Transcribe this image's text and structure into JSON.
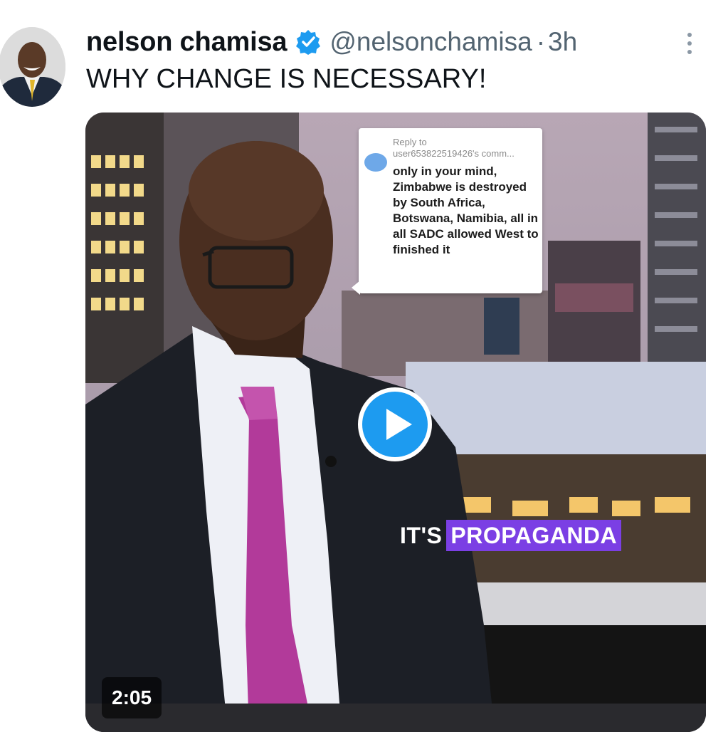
{
  "tweet": {
    "author_name": "nelson chamisa",
    "handle": "@nelsonchamisa",
    "separator": "·",
    "time": "3h",
    "text": "WHY CHANGE IS NECESSARY!",
    "verified": true
  },
  "video": {
    "comment_reply_to_line1": "Reply to",
    "comment_reply_to_line2": "user653822519426's comm...",
    "comment_text": "only in your mind, Zimbabwe is destroyed by South Africa, Botswana, Namibia, all in all SADC allowed West to finished it",
    "caption_prefix": "IT'S",
    "caption_highlight": "PROPAGANDA",
    "duration": "2:05",
    "play_state": "paused"
  },
  "icons": [
    "verified-badge-icon",
    "more-options-icon",
    "play-icon"
  ],
  "colors": {
    "verified": "#1d9bf0",
    "play_button": "#1d9bf0",
    "caption_highlight": "#7b3fe4",
    "handle_text": "#536471"
  }
}
